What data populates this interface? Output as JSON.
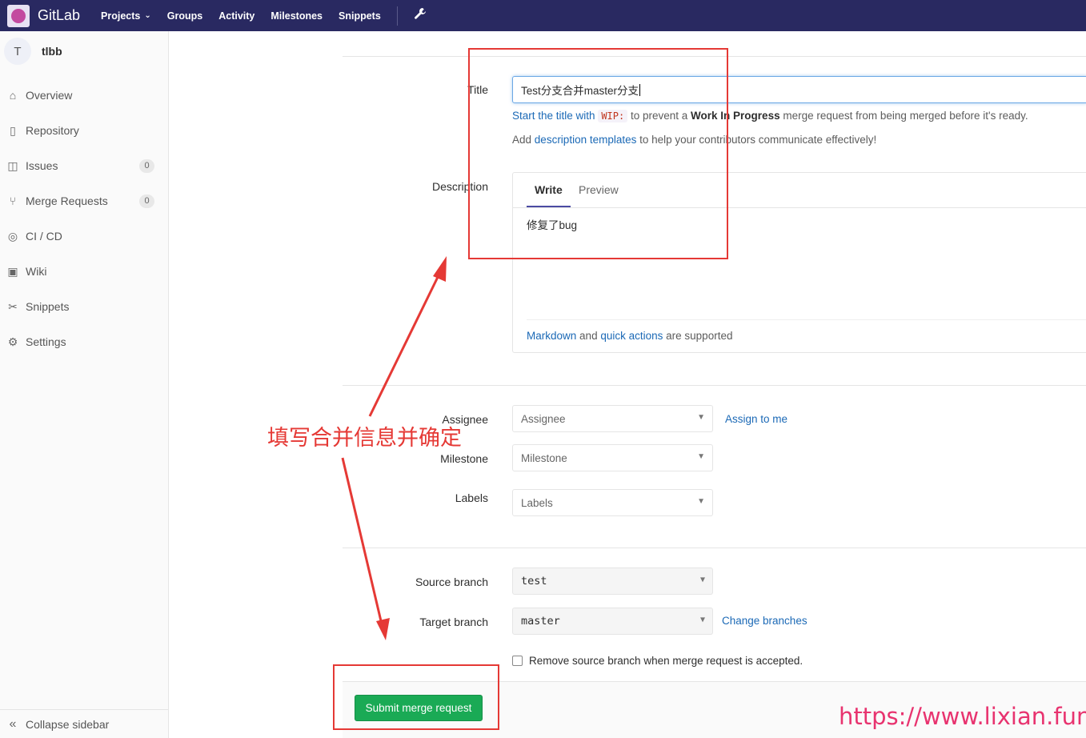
{
  "navbar": {
    "brand": "GitLab",
    "links": [
      "Projects",
      "Groups",
      "Activity",
      "Milestones",
      "Snippets"
    ]
  },
  "sidebar": {
    "avatar_letter": "T",
    "project_name": "tlbb",
    "items": [
      {
        "label": "Overview",
        "icon": "home-icon"
      },
      {
        "label": "Repository",
        "icon": "file-icon"
      },
      {
        "label": "Issues",
        "icon": "issues-icon",
        "count": "0"
      },
      {
        "label": "Merge Requests",
        "icon": "merge-request-icon",
        "count": "0"
      },
      {
        "label": "CI / CD",
        "icon": "rocket-icon"
      },
      {
        "label": "Wiki",
        "icon": "book-icon"
      },
      {
        "label": "Snippets",
        "icon": "scissors-icon"
      },
      {
        "label": "Settings",
        "icon": "gear-icon"
      }
    ],
    "collapse_label": "Collapse sidebar"
  },
  "form": {
    "title_label": "Title",
    "title_value": "Test分支合并master分支",
    "wip_help_link": "Start the title with",
    "wip_code": "WIP:",
    "wip_help_rest_1": "to prevent a",
    "wip_help_bold": "Work In Progress",
    "wip_help_rest_2": "merge request from being merged before it's ready.",
    "templates_prefix": "Add",
    "templates_link": "description templates",
    "templates_suffix": "to help your contributors communicate effectively!",
    "description_label": "Description",
    "tab_write": "Write",
    "tab_preview": "Preview",
    "description_value": "修复了bug",
    "markdown_link": "Markdown",
    "and_text": "and",
    "quick_actions_link": "quick actions",
    "supported_text": "are supported",
    "assignee_label": "Assignee",
    "assignee_placeholder": "Assignee",
    "assign_to_me": "Assign to me",
    "milestone_label": "Milestone",
    "milestone_placeholder": "Milestone",
    "labels_label": "Labels",
    "labels_placeholder": "Labels",
    "source_branch_label": "Source branch",
    "source_branch_value": "test",
    "target_branch_label": "Target branch",
    "target_branch_value": "master",
    "change_branches": "Change branches",
    "remove_source_checkbox": "Remove source branch when merge request is accepted.",
    "submit_label": "Submit merge request"
  },
  "annotation": {
    "text": "填写合并信息并确定",
    "color": "#e53935"
  },
  "watermark": "https://www.lixian.fun"
}
